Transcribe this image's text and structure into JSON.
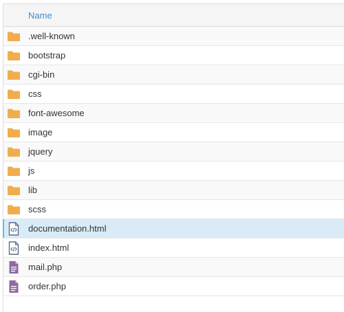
{
  "header": {
    "name_label": "Name"
  },
  "colors": {
    "folder": "#f0ad4e",
    "html_file": "#5b6a8a",
    "php_file": "#8e6aa3",
    "link": "#428bca",
    "selected_row": "#d9ebf7"
  },
  "items": [
    {
      "name": ".well-known",
      "icon": "folder-icon"
    },
    {
      "name": "bootstrap",
      "icon": "folder-icon"
    },
    {
      "name": "cgi-bin",
      "icon": "folder-icon"
    },
    {
      "name": "css",
      "icon": "folder-icon"
    },
    {
      "name": "font-awesome",
      "icon": "folder-icon"
    },
    {
      "name": "image",
      "icon": "folder-icon"
    },
    {
      "name": "jquery",
      "icon": "folder-icon"
    },
    {
      "name": "js",
      "icon": "folder-icon"
    },
    {
      "name": "lib",
      "icon": "folder-icon"
    },
    {
      "name": "scss",
      "icon": "folder-icon"
    },
    {
      "name": "documentation.html",
      "icon": "html-file-icon",
      "selected": true
    },
    {
      "name": "index.html",
      "icon": "html-file-icon"
    },
    {
      "name": "mail.php",
      "icon": "php-file-icon"
    },
    {
      "name": "order.php",
      "icon": "php-file-icon"
    }
  ]
}
